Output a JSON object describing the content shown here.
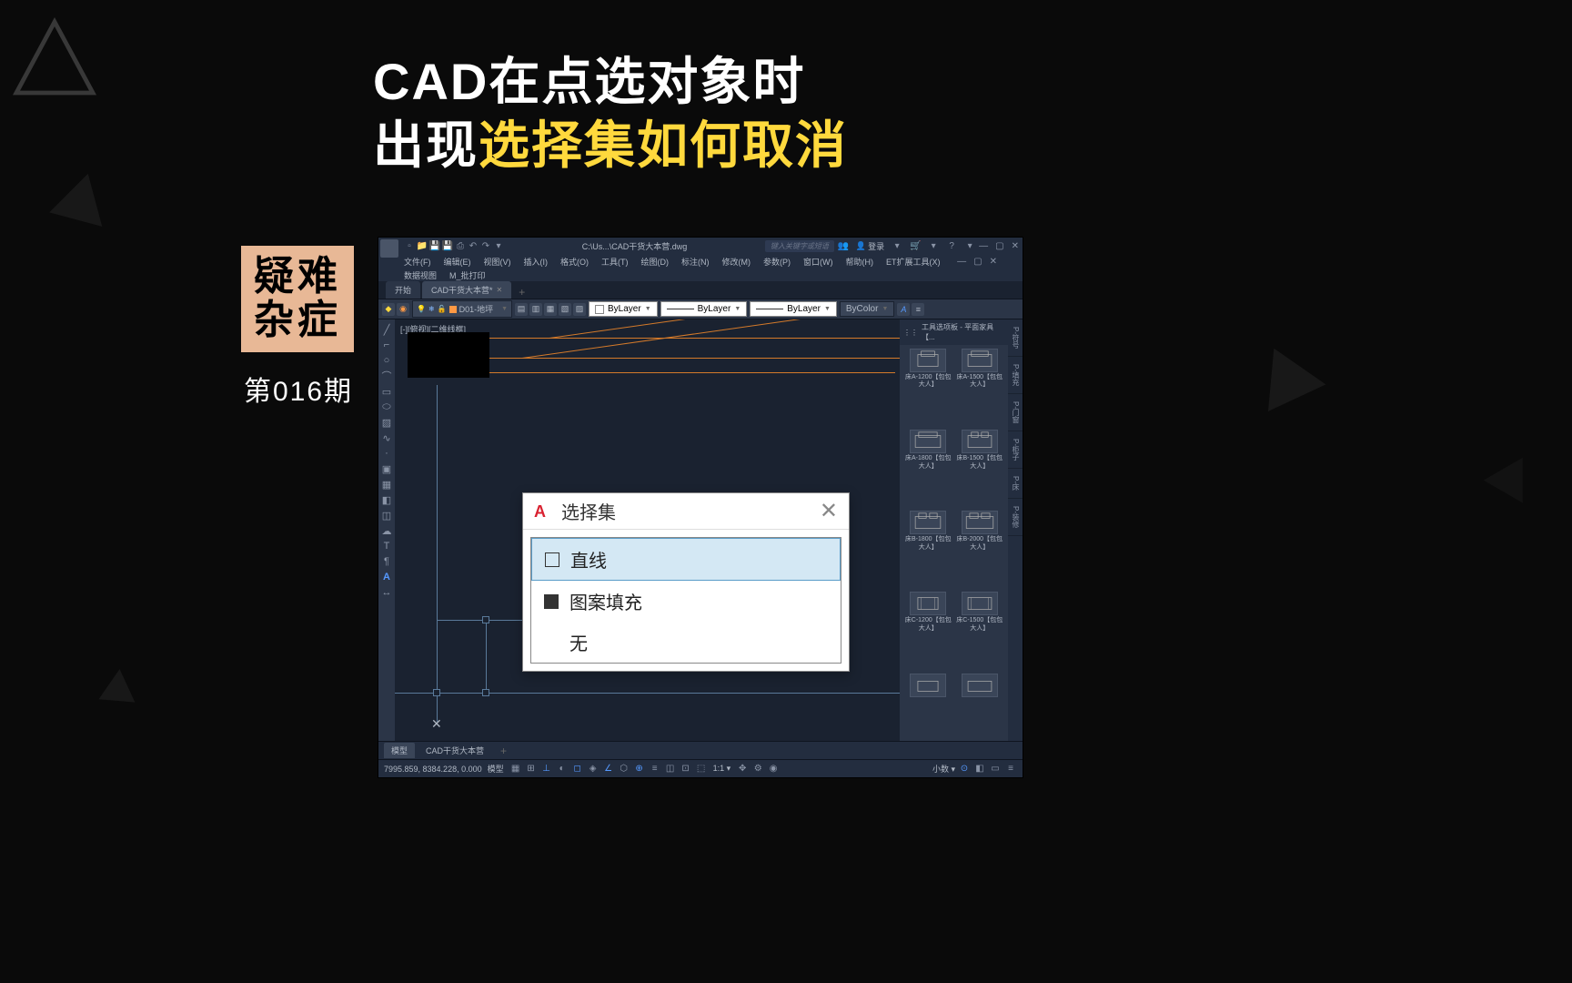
{
  "headline": {
    "line1a": "CAD在点选对象时",
    "line2a": "出现",
    "line2b": "选择集如何取消"
  },
  "badge": {
    "top": "疑难",
    "bottom": "杂症"
  },
  "episode": "第016期",
  "titlebar": {
    "path": "C:\\Us...\\CAD干货大本营.dwg",
    "search_ph": "键入关键字或短语",
    "login": "登录"
  },
  "menus": [
    "文件(F)",
    "编辑(E)",
    "视图(V)",
    "插入(I)",
    "格式(O)",
    "工具(T)",
    "绘图(D)",
    "标注(N)",
    "修改(M)",
    "参数(P)",
    "窗口(W)",
    "帮助(H)",
    "ET扩展工具(X)"
  ],
  "menus2": [
    "数据视图",
    "M_批打印"
  ],
  "doctabs": {
    "t1": "开始",
    "t2": "CAD干货大本营*"
  },
  "propbar": {
    "layer": "D01-地坪",
    "bylayer1": "ByLayer",
    "bylayer2": "ByLayer",
    "bylayer3": "ByLayer",
    "bycolor": "ByColor"
  },
  "canvas": {
    "label": "[-][俯视][二维线框]"
  },
  "palette": {
    "title": "工具选项板 - 平面家具【...",
    "tabs": [
      "P-符号",
      "P-填充",
      "P-门窗",
      "P-柜子",
      "P-床",
      "P-装修"
    ],
    "items": [
      "床A-1200【包包大人】",
      "床A-1500【包包大人】",
      "床A-1800【包包大人】",
      "床B-1500【包包大人】",
      "床B-1800【包包大人】",
      "床B-2000【包包大人】",
      "床C-1200【包包大人】",
      "床C-1500【包包大人】"
    ]
  },
  "btabs": {
    "t1": "模型",
    "t2": "CAD干货大本营"
  },
  "statusbar": {
    "coords": "7995.859, 8384.228, 0.000",
    "model": "模型",
    "ratio": "1:1",
    "decimal": "小数"
  },
  "dialog": {
    "title": "选择集",
    "item1": "直线",
    "item2": "图案填充",
    "item3": "无"
  }
}
